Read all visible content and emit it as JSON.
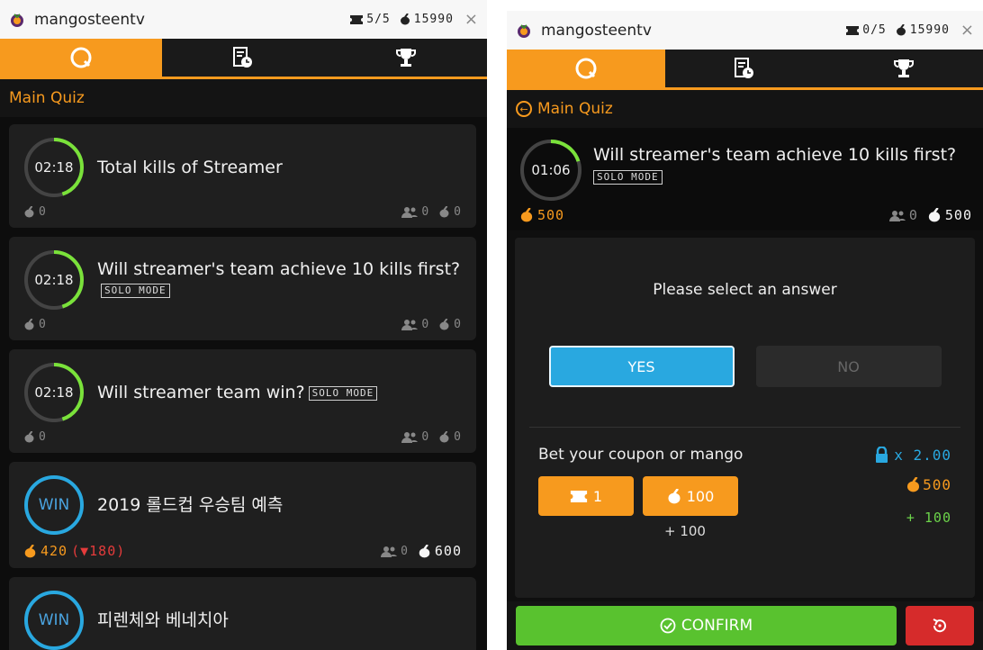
{
  "left": {
    "app_name": "mangosteentv",
    "ticket_count": "5/5",
    "mango_balance": "15990",
    "breadcrumb": "Main Quiz",
    "quizzes": [
      {
        "timer": "02:18",
        "question": "Total kills of Streamer",
        "solo": "",
        "mango_bet": "0",
        "participants": "0",
        "pool": "0",
        "progress": 0.45
      },
      {
        "timer": "02:18",
        "question": "Will streamer's team achieve 10 kills first?",
        "solo": "SOLO MODE",
        "mango_bet": "0",
        "participants": "0",
        "pool": "0",
        "progress": 0.45
      },
      {
        "timer": "02:18",
        "question": "Will streamer team win?",
        "solo": "SOLO MODE",
        "mango_bet": "0",
        "participants": "0",
        "pool": "0",
        "progress": 0.45
      },
      {
        "timer": "WIN",
        "question": "2019 롤드컵 우승팀 예측",
        "solo": "",
        "mango_bet": "420",
        "loss": "(▼180)",
        "participants": "0",
        "pool": "600"
      },
      {
        "timer": "WIN",
        "question": "피렌체와 베네치아",
        "solo": ""
      }
    ]
  },
  "right": {
    "app_name": "mangosteentv",
    "ticket_count": "0/5",
    "mango_balance": "15990",
    "breadcrumb": "Main Quiz",
    "timer": "01:06",
    "question": "Will streamer's team achieve 10 kills first?",
    "solo": "SOLO MODE",
    "my_bet": "500",
    "participants": "0",
    "pool": "500",
    "prompt": "Please select an answer",
    "yes_label": "YES",
    "no_label": "NO",
    "bet_label": "Bet your coupon or mango",
    "multiplier": "x 2.00",
    "coupon_bet": "1",
    "mango_bet": "100",
    "plus_amount": "+ 100",
    "pot": "500",
    "delta": "+ 100",
    "confirm_label": "CONFIRM",
    "timer_progress": 0.2
  },
  "colors": {
    "accent": "#f79a1e",
    "blue": "#29a8e0",
    "green": "#59c22f",
    "red": "#d62b2b"
  }
}
